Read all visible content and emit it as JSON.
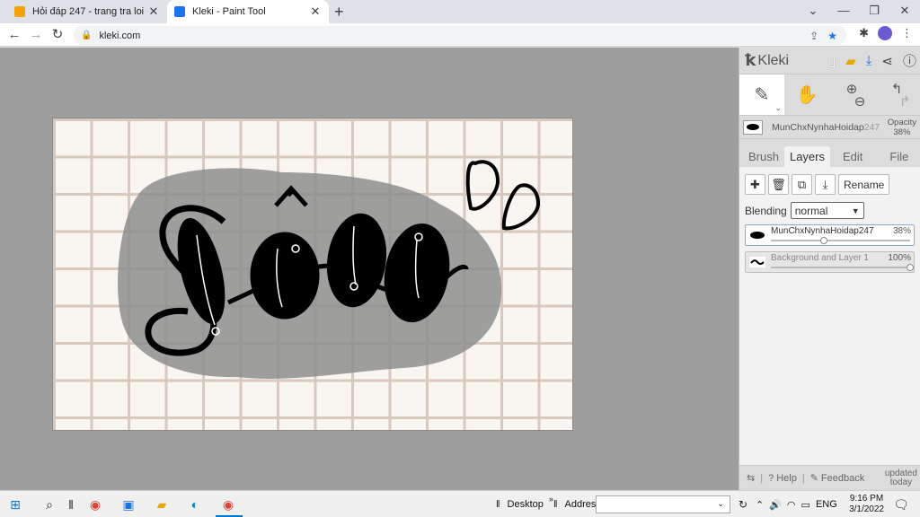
{
  "browser": {
    "tabs": [
      {
        "title": "Hỏi đáp 247 - trang tra loi",
        "favicon_color": "#f2a20b",
        "active": false
      },
      {
        "title": "Kleki - Paint Tool",
        "favicon_color": "#1a73e8",
        "active": true
      }
    ],
    "url": "kleki.com",
    "icons": {
      "back": "arrow-left-icon",
      "forward": "arrow-right-icon",
      "reload": "reload-icon",
      "share": "share-icon",
      "bookmark": "star-icon",
      "extensions": "puzzle-icon",
      "menu": "kebab-menu-icon"
    }
  },
  "kleki": {
    "brand": "Kleki",
    "brush_layer_name": "MunChxNynhaHoidap",
    "brush_layer_name_faded": "247",
    "opacity_label": "Opacity",
    "opacity_value": "38%",
    "tabs": [
      "Brush",
      "Layers",
      "Edit",
      "File"
    ],
    "active_tab": "Layers",
    "rename_label": "Rename",
    "blending_label": "Blending",
    "blending_value": "normal",
    "layers": [
      {
        "name": "MunChxNynhaHoidap247",
        "opacity": "38%",
        "opacity_fraction": 0.38,
        "selected": true
      },
      {
        "name": "Background and Layer 1",
        "opacity": "100%",
        "opacity_fraction": 1.0,
        "selected": false
      }
    ],
    "footer": {
      "help": "Help",
      "feedback": "Feedback",
      "updated_line1": "updated",
      "updated_line2": "today"
    },
    "canvas_text": "Sồu"
  },
  "taskbar": {
    "desktop_label": "Desktop",
    "address_label": "Address",
    "language": "ENG",
    "time": "9:16 PM",
    "date": "3/1/2022"
  }
}
